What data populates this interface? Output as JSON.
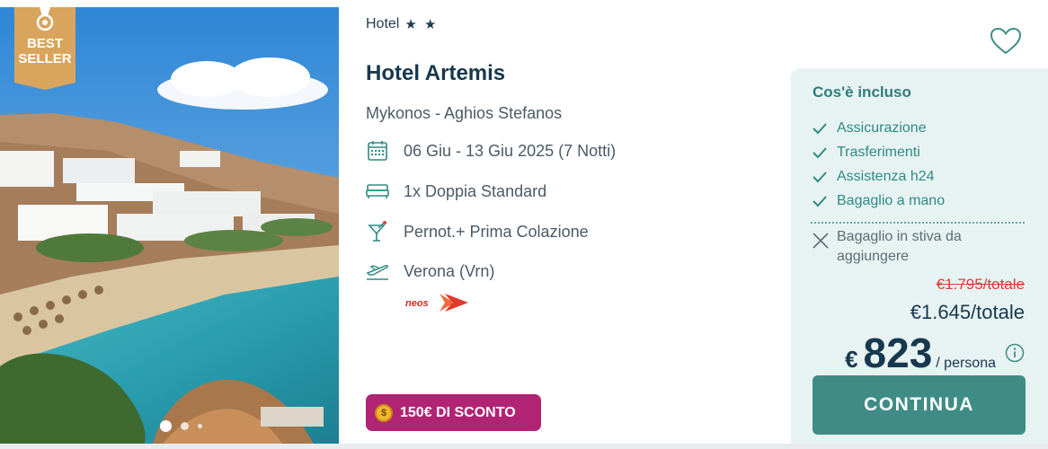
{
  "colors": {
    "brand_dark": "#17384e",
    "accent_teal": "#3f8c86",
    "panel_bg": "#e7f3f2",
    "discount_bg": "#b12474",
    "ribbon": "#d9a55c",
    "old_price_red": "#d6413b"
  },
  "badge": {
    "label_line1": "BEST",
    "label_line2": "SELLER"
  },
  "hotel": {
    "category": "Hotel",
    "stars": 2,
    "stars_text": "★ ★",
    "name": "Hotel Artemis",
    "location": "Mykonos - Aghios Stefanos"
  },
  "details": {
    "dates": "06 Giu - 13 Giu 2025 (7 Notti)",
    "room": "1x Doppia Standard",
    "board": "Pernot.+ Prima Colazione",
    "departure": "Verona (Vrn)",
    "airline_logo": "neos"
  },
  "discount": {
    "label": "150€ DI SCONTO",
    "coin_symbol": "$"
  },
  "gallery": {
    "dots": 3,
    "active": 1
  },
  "included": {
    "title": "Cos'è incluso",
    "items": [
      "Assicurazione",
      "Trasferimenti",
      "Assistenza h24",
      "Bagaglio a mano"
    ],
    "excluded": [
      "Bagaglio in stiva da aggiungere"
    ]
  },
  "price": {
    "old_total": "€1.795/totale",
    "total": "€1.645/totale",
    "currency": "€",
    "per_person_amount": "823",
    "per_person_label": "/ persona"
  },
  "cta": {
    "label": "CONTINUA"
  },
  "icons": {
    "heart": "heart-icon",
    "calendar": "calendar-icon",
    "bed": "bed-icon",
    "cocktail": "cocktail-icon",
    "plane": "plane-departure-icon",
    "check": "check-icon",
    "close": "close-icon",
    "info": "info-icon",
    "coin": "coin-icon",
    "medal": "medal-icon"
  }
}
